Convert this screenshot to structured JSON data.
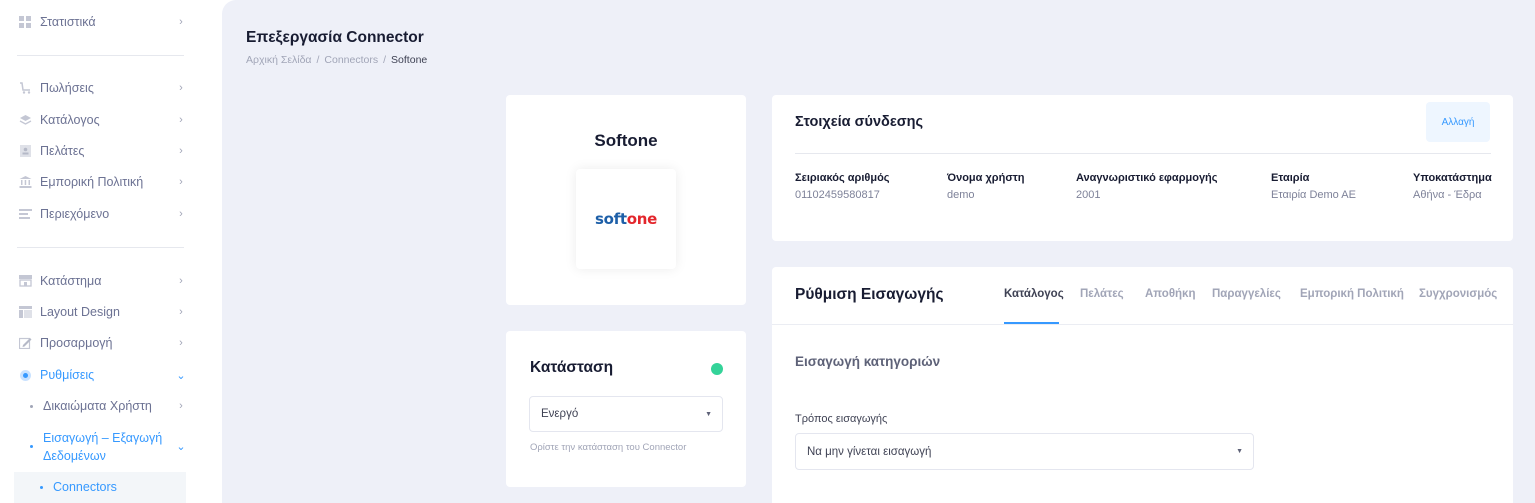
{
  "sidebar": {
    "items": [
      {
        "label": "Στατιστικά",
        "icon": "grid-icon"
      },
      {
        "label": "Πωλήσεις",
        "icon": "cart-icon"
      },
      {
        "label": "Κατάλογος",
        "icon": "layers-icon"
      },
      {
        "label": "Πελάτες",
        "icon": "address-book-icon"
      },
      {
        "label": "Εμπορική Πολιτική",
        "icon": "bank-icon"
      },
      {
        "label": "Περιεχόμενο",
        "icon": "text-icon"
      },
      {
        "label": "Κατάστημα",
        "icon": "store-icon"
      },
      {
        "label": "Layout Design",
        "icon": "layout-icon"
      },
      {
        "label": "Προσαρμογή",
        "icon": "edit-icon"
      },
      {
        "label": "Ρυθμίσεις",
        "icon": "settings-icon"
      }
    ],
    "sub_items": [
      {
        "label": "Δικαιώματα Χρήστη"
      },
      {
        "label_line1": "Εισαγωγή – Εξαγωγή",
        "label_line2": "Δεδομένων"
      }
    ],
    "active_leaf": "Connectors"
  },
  "header": {
    "title": "Επεξεργασία Connector",
    "breadcrumb": [
      "Αρχική Σελίδα",
      "Connectors",
      "Softone"
    ],
    "separator": "/"
  },
  "connector_card": {
    "name": "Softone",
    "logo_soft": "soft",
    "logo_one": "one"
  },
  "status_card": {
    "title": "Κατάσταση",
    "status_color": "#34d399",
    "selected": "Ενεργό",
    "help": "Ορίστε την κατάσταση του Connector"
  },
  "connection": {
    "title": "Στοιχεία σύνδεσης",
    "change_button": "Αλλαγή",
    "fields": [
      {
        "label": "Σειριακός αριθμός",
        "value": "01102459580817"
      },
      {
        "label": "Όνομα χρήστη",
        "value": "demo"
      },
      {
        "label": "Αναγνωριστικό εφαρμογής",
        "value": "2001"
      },
      {
        "label": "Εταιρία",
        "value": "Εταιρία Demo AE"
      },
      {
        "label": "Υποκατάστημα",
        "value": "Αθήνα - Έδρα"
      }
    ]
  },
  "import_settings": {
    "title": "Ρύθμιση Εισαγωγής",
    "tabs": [
      "Κατάλογος",
      "Πελάτες",
      "Αποθήκη",
      "Παραγγελίες",
      "Εμπορική Πολιτική",
      "Συγχρονισμός"
    ],
    "active_tab": "Κατάλογος",
    "section_title": "Εισαγωγή κατηγοριών",
    "field_label": "Τρόπος εισαγωγής",
    "field_value": "Να μην γίνεται εισαγωγή"
  },
  "colors": {
    "accent": "#3699ff",
    "background": "#eef0f8"
  }
}
